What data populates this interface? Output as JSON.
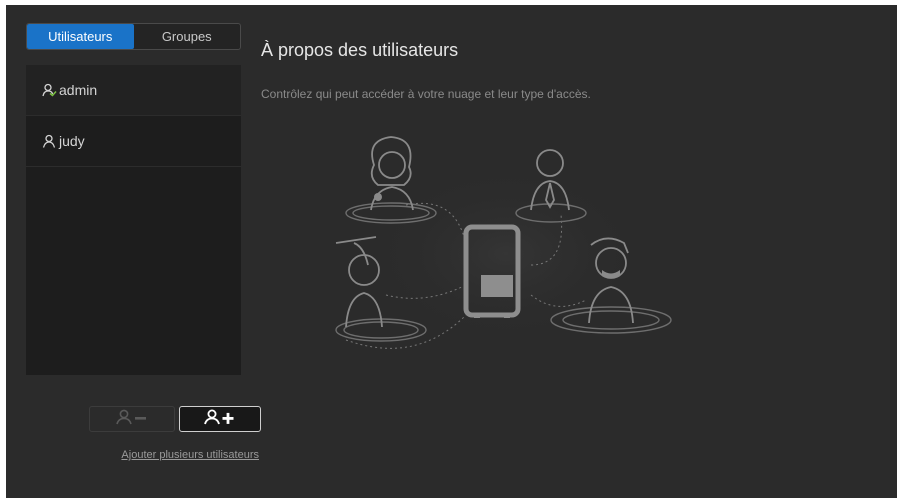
{
  "tabs": {
    "users_label": "Utilisateurs",
    "groups_label": "Groupes"
  },
  "users": [
    {
      "name": "admin",
      "icon": "admin-user-icon"
    },
    {
      "name": "judy",
      "icon": "user-icon"
    }
  ],
  "actions": {
    "remove_icon": "remove-user-icon",
    "add_icon": "add-user-icon",
    "add_multiple_label": "Ajouter plusieurs utilisateurs"
  },
  "main": {
    "title": "À propos des utilisateurs",
    "subtitle": "Contrôlez qui peut accéder à votre nuage et leur type d'accès."
  },
  "colors": {
    "accent": "#1a73c8",
    "background": "#2b2b2b",
    "panel": "#1d1d1d"
  }
}
